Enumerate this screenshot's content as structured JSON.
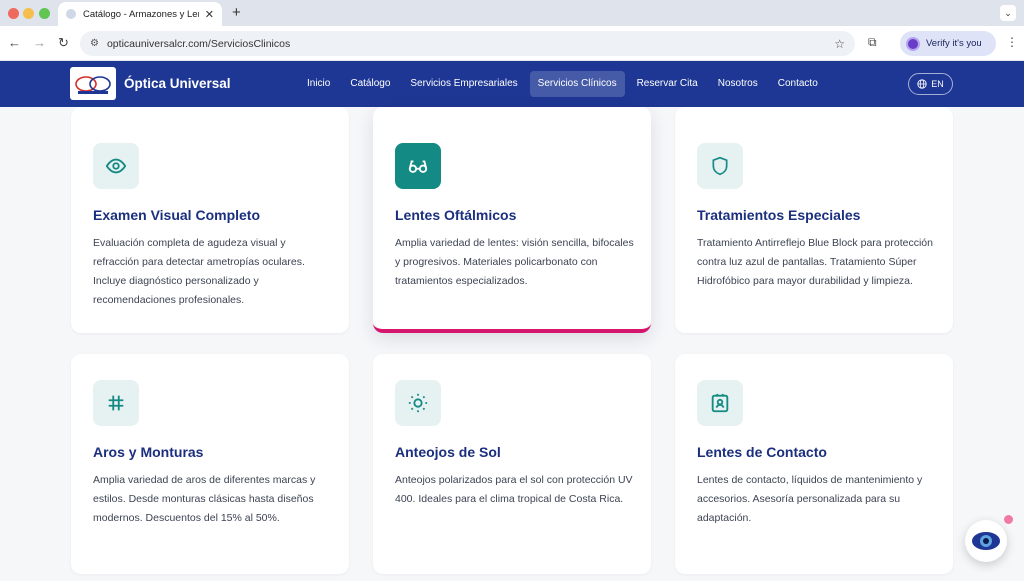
{
  "browser": {
    "tab_title": "Catálogo - Armazones y Lent",
    "url": "opticauniversalcr.com/ServiciosClinicos",
    "profile_label": "Verify it's you"
  },
  "site": {
    "brand": "Óptica Universal",
    "nav": [
      {
        "label": "Inicio",
        "active": false
      },
      {
        "label": "Catálogo",
        "active": false
      },
      {
        "label": "Servicios Empresariales",
        "active": false
      },
      {
        "label": "Servicios Clínicos",
        "active": true
      },
      {
        "label": "Reservar Cita",
        "active": false
      },
      {
        "label": "Nosotros",
        "active": false
      },
      {
        "label": "Contacto",
        "active": false
      }
    ],
    "lang_label": "EN"
  },
  "colors": {
    "nav_bg": "#1e3794",
    "title": "#1b2f7f",
    "icon_teal": "#148a84",
    "accent_pink": "#d6166e"
  },
  "cards": [
    {
      "icon": "eye-icon",
      "title": "Examen Visual Completo",
      "text": "Evaluación completa de agudeza visual y refracción para detectar ametropías oculares. Incluye diagnóstico personalizado y recomendaciones profesionales."
    },
    {
      "icon": "glasses-icon",
      "title": "Lentes Oftálmicos",
      "text": "Amplia variedad de lentes: visión sencilla, bifocales y progresivos. Materiales policarbonato con tratamientos especializados."
    },
    {
      "icon": "shield-icon",
      "title": "Tratamientos Especiales",
      "text": "Tratamiento Antirreflejo Blue Block para protección contra luz azul de pantallas. Tratamiento Súper Hidrofóbico para mayor durabilidad y limpieza."
    },
    {
      "icon": "frame-icon",
      "title": "Aros y Monturas",
      "text": "Amplia variedad de aros de diferentes marcas y estilos. Desde monturas clásicas hasta diseños modernos. Descuentos del 15% al 50%."
    },
    {
      "icon": "sun-icon",
      "title": "Anteojos de Sol",
      "text": "Anteojos polarizados para el sol con protección UV 400. Ideales para el clima tropical de Costa Rica."
    },
    {
      "icon": "contact-lens-icon",
      "title": "Lentes de Contacto",
      "text": "Lentes de contacto, líquidos de mantenimiento y accesorios. Asesoría personalizada para su adaptación."
    }
  ]
}
